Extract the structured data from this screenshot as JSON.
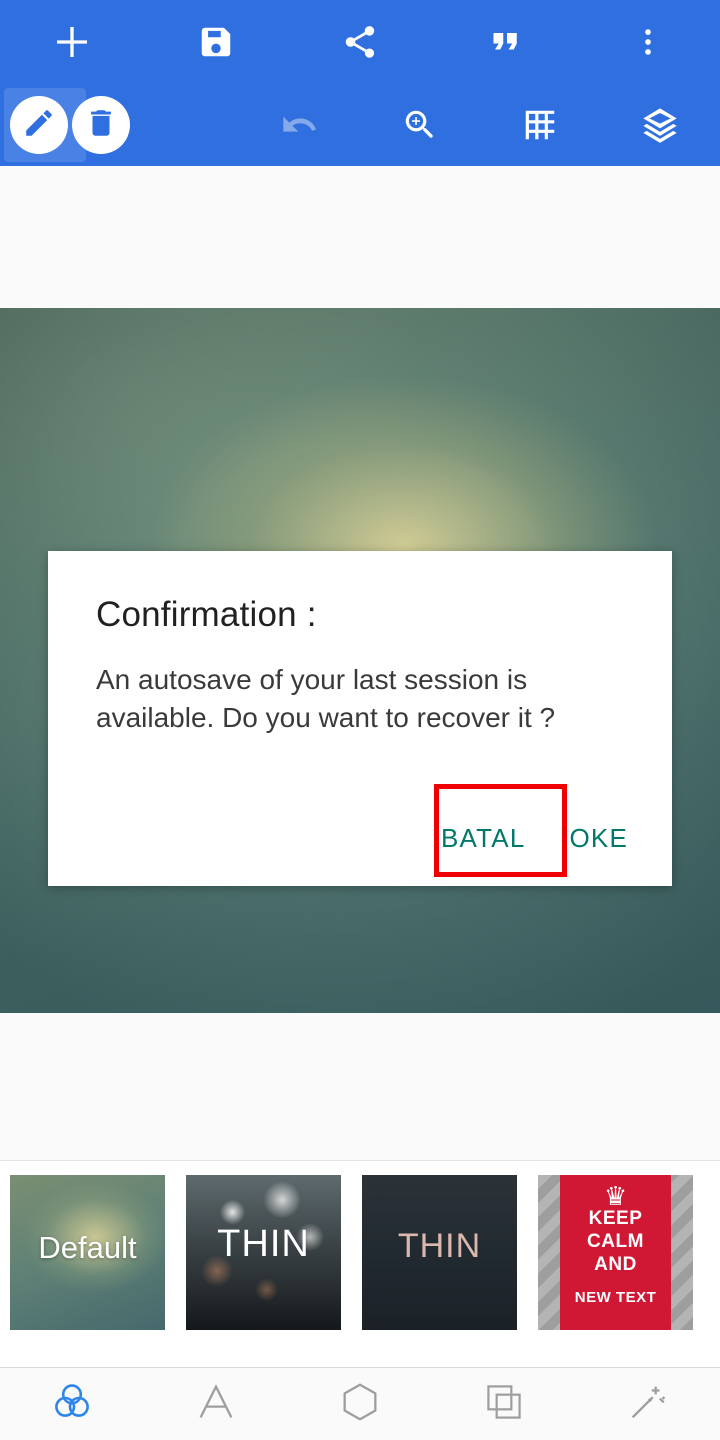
{
  "toolbar": {
    "row1": [
      {
        "name": "add-icon",
        "label": "Add"
      },
      {
        "name": "save-icon",
        "label": "Save"
      },
      {
        "name": "share-icon",
        "label": "Share"
      },
      {
        "name": "quote-icon",
        "label": "Quote"
      },
      {
        "name": "overflow-menu-icon",
        "label": "More options"
      }
    ],
    "row2": [
      {
        "name": "pencil-tool-icon",
        "label": "Draw"
      },
      {
        "name": "delete-tool-icon",
        "label": "Delete"
      },
      {
        "name": "undo-icon",
        "label": "Undo"
      },
      {
        "name": "zoom-in-icon",
        "label": "Zoom"
      },
      {
        "name": "grid-icon",
        "label": "Grid"
      },
      {
        "name": "layers-icon",
        "label": "Layers"
      }
    ],
    "accent_color": "#2f6fe0"
  },
  "dialog": {
    "title": "Confirmation :",
    "message": "An autosave of your last session is available. Do you want to recover it ?",
    "cancel_label": "BATAL",
    "confirm_label": "OKE",
    "button_color": "#00796b",
    "highlight_color": "#ee0000",
    "highlighted_button": "BATAL"
  },
  "thumbnails": [
    {
      "name": "template-default",
      "label": "Default"
    },
    {
      "name": "template-thin-bokeh",
      "label": "THIN"
    },
    {
      "name": "template-thin-dark",
      "label": "THIN"
    },
    {
      "name": "template-keep-calm",
      "label": "KEEP CALM AND NEW TEXT",
      "crown": "♛",
      "line1": "KEEP",
      "line2": "CALM",
      "line3": "AND",
      "line4": "NEW TEXT"
    }
  ],
  "bottom_nav": [
    {
      "name": "filters-icon",
      "label": "Filters",
      "active": true
    },
    {
      "name": "text-icon",
      "label": "Text",
      "active": false
    },
    {
      "name": "shape-icon",
      "label": "Shape",
      "active": false
    },
    {
      "name": "frames-icon",
      "label": "Frames",
      "active": false
    },
    {
      "name": "magic-wand-icon",
      "label": "Effects",
      "active": false
    }
  ],
  "colors": {
    "nav_active": "#2f86e8",
    "nav_inactive": "#9e9e9e",
    "canvas_bg": "#5d8076"
  }
}
